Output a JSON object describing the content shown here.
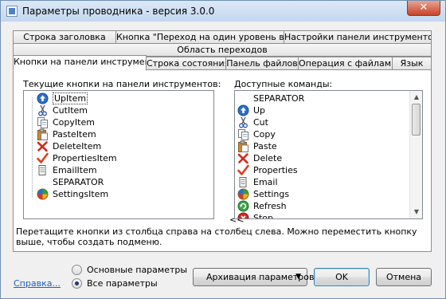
{
  "window": {
    "title": "Параметры проводника - версия 3.0.0",
    "close_label": "✕"
  },
  "tabs_row1": [
    {
      "label": "Строка заголовка"
    },
    {
      "label": "Кнопка \"Переход на один уровень вверх\""
    },
    {
      "label": "Настройки панели инструментов"
    }
  ],
  "tabs_row2": [
    {
      "label": "Область переходов"
    }
  ],
  "tabs_row3": [
    {
      "label": "Кнопки на панели инструментов",
      "active": true
    },
    {
      "label": "Строка состояния"
    },
    {
      "label": "Панель файлов"
    },
    {
      "label": "Операция с файлами"
    },
    {
      "label": "Язык"
    }
  ],
  "left_list": {
    "title": "Текущие кнопки на панели инструментов:",
    "items": [
      {
        "label": "UpItem",
        "icon": "up-arrow-icon",
        "selected": true
      },
      {
        "label": "CutItem",
        "icon": "scissors-icon"
      },
      {
        "label": "CopyItem",
        "icon": "copy-icon"
      },
      {
        "label": "PasteItem",
        "icon": "paste-icon"
      },
      {
        "label": "DeleteItem",
        "icon": "delete-x-icon"
      },
      {
        "label": "PropertiesItem",
        "icon": "checkmark-icon"
      },
      {
        "label": "EmailItem",
        "icon": "email-icon"
      },
      {
        "label": "SEPARATOR",
        "icon": "none"
      },
      {
        "label": "SettingsItem",
        "icon": "settings-globe-icon"
      }
    ]
  },
  "move_button_label": "<<",
  "right_list": {
    "title": "Доступные команды:",
    "items": [
      {
        "label": "SEPARATOR",
        "icon": "none"
      },
      {
        "label": "Up",
        "icon": "up-arrow-icon"
      },
      {
        "label": "Cut",
        "icon": "scissors-icon"
      },
      {
        "label": "Copy",
        "icon": "copy-icon"
      },
      {
        "label": "Paste",
        "icon": "paste-icon"
      },
      {
        "label": "Delete",
        "icon": "delete-x-icon"
      },
      {
        "label": "Properties",
        "icon": "checkmark-icon"
      },
      {
        "label": "Email",
        "icon": "email-icon"
      },
      {
        "label": "Settings",
        "icon": "settings-globe-icon"
      },
      {
        "label": "Refresh",
        "icon": "refresh-icon"
      },
      {
        "label": "Stop",
        "icon": "stop-icon"
      }
    ]
  },
  "hint_text": "Перетащите кнопки из столбца справа на столбец слева. Можно переместить кнопку выше, чтобы создать подменю.",
  "footer": {
    "help_link": "Справка...",
    "radio_basic": "Основные параметры",
    "radio_all": "Все параметры",
    "radio_selected": "all",
    "archive_button": "Архивация параметров",
    "ok_button": "OK",
    "cancel_button": "Отмена"
  },
  "colors": {
    "link": "#1e5fb8",
    "title_bar": "#c4d8ef",
    "close": "#c7432a"
  }
}
